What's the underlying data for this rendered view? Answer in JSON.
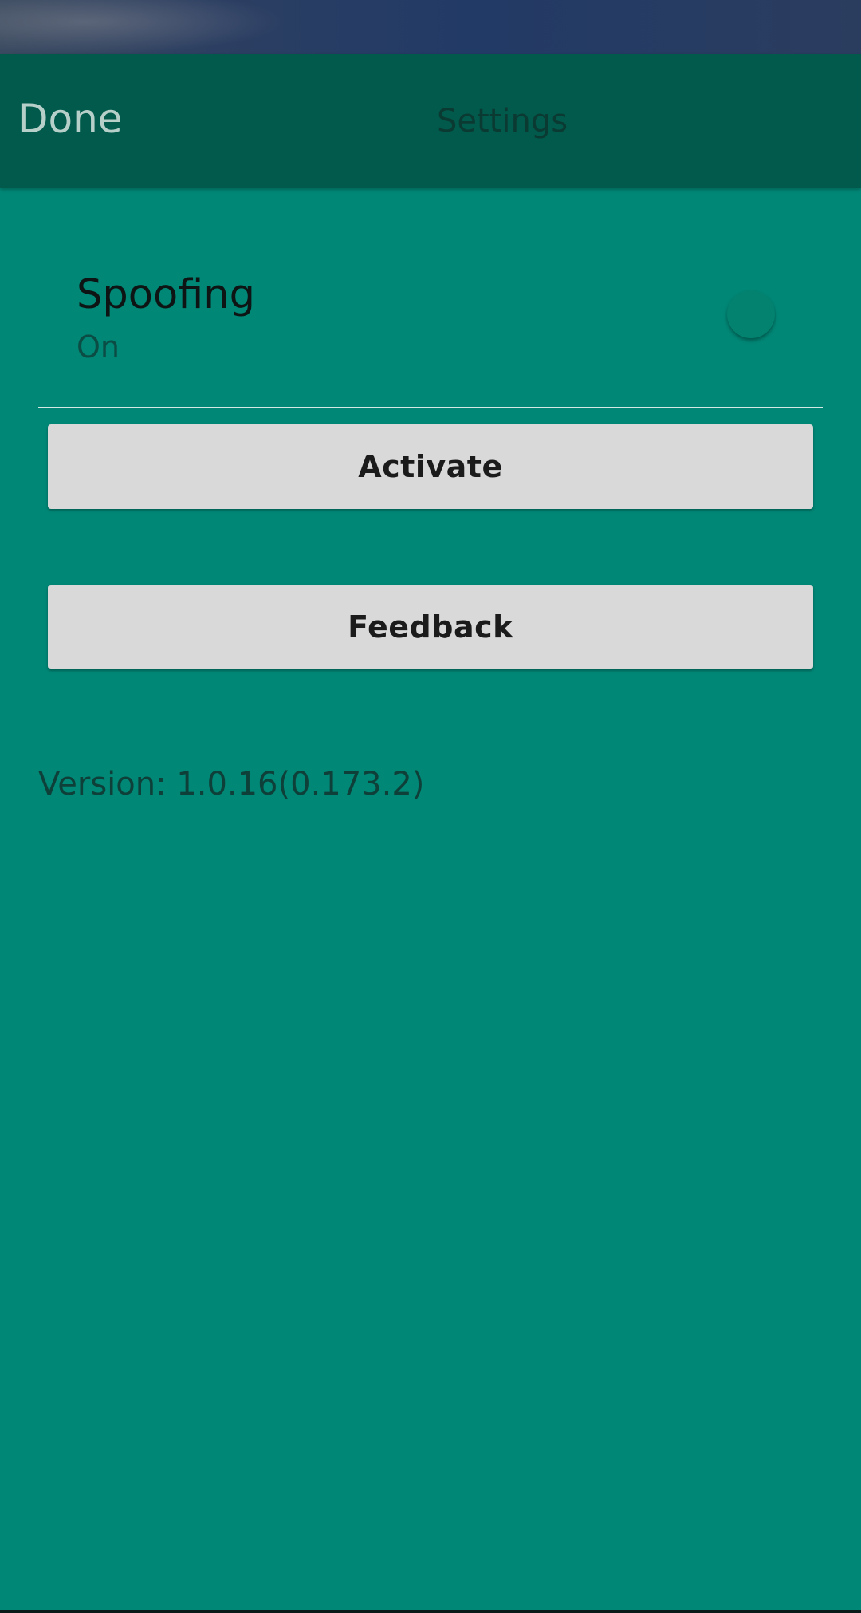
{
  "toolbar": {
    "done_label": "Done",
    "title": "Settings"
  },
  "spoofing": {
    "title": "Spoofing",
    "summary": "On"
  },
  "buttons": {
    "activate": "Activate",
    "feedback": "Feedback"
  },
  "version": "Version: 1.0.16(0.173.2)",
  "colors": {
    "background": "#018776",
    "toolbar": "#015a4c",
    "button": "#d8d9d8"
  }
}
